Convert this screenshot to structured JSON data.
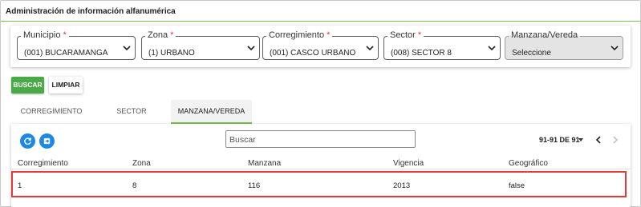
{
  "panel": {
    "title": "Administración de información alfanumérica"
  },
  "filters": [
    {
      "label": "Municipio",
      "required": "*",
      "value": "(001) BUCARAMANGA"
    },
    {
      "label": "Zona",
      "required": "*",
      "value": "(1) URBANO"
    },
    {
      "label": "Corregimiento",
      "required": "*",
      "value": "(001) CASCO URBANO"
    },
    {
      "label": "Sector",
      "required": "*",
      "value": "(008) SECTOR 8"
    },
    {
      "label": "Manzana/Vereda",
      "required": "",
      "value": "Seleccione"
    }
  ],
  "actions": {
    "search_label": "BUSCAR",
    "clear_label": "LIMPIAR"
  },
  "tabs": [
    {
      "label": "CORREGIMIENTO",
      "active": false
    },
    {
      "label": "SECTOR",
      "active": false
    },
    {
      "label": "MANZANA/VEREDA",
      "active": true
    }
  ],
  "toolbar": {
    "refresh_icon": "refresh-icon",
    "export_icon": "export-icon",
    "search_placeholder": "Buscar"
  },
  "pager": {
    "range_text": "91-91 DE 91"
  },
  "table": {
    "columns": [
      "Corregimiento",
      "Zona",
      "Manzana",
      "Vigencia",
      "Geográfico"
    ],
    "rows": [
      [
        "1",
        "8",
        "116",
        "2013",
        "false"
      ]
    ]
  },
  "colors": {
    "accent_green": "#4aaa47",
    "tab_underline": "#7cc24a",
    "icon_blue": "#1e88e5",
    "highlight_red": "#e53935"
  }
}
